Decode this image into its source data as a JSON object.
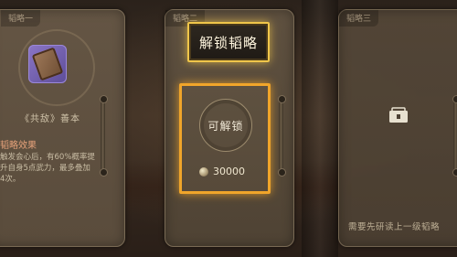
{
  "cards": {
    "left": {
      "tab": "韬略一",
      "book_name": "《共敌》善本",
      "effect_title": "韬略效果",
      "effect_text": "触发会心后，有60%概率提升自身5点武力，最多叠加4次。"
    },
    "mid": {
      "tab": "韬略二",
      "unlock_button": "解锁韬略",
      "status": "可解锁",
      "cost": "30000"
    },
    "right": {
      "tab": "韬略三",
      "requirement": "需要先研读上一级韬略"
    }
  },
  "colors": {
    "highlight_gold": "#f0c64a",
    "highlight_orange": "#f0a52a",
    "effect_title": "#e6a27a"
  },
  "icons": [
    "book-icon",
    "coin-icon",
    "lock-icon"
  ]
}
